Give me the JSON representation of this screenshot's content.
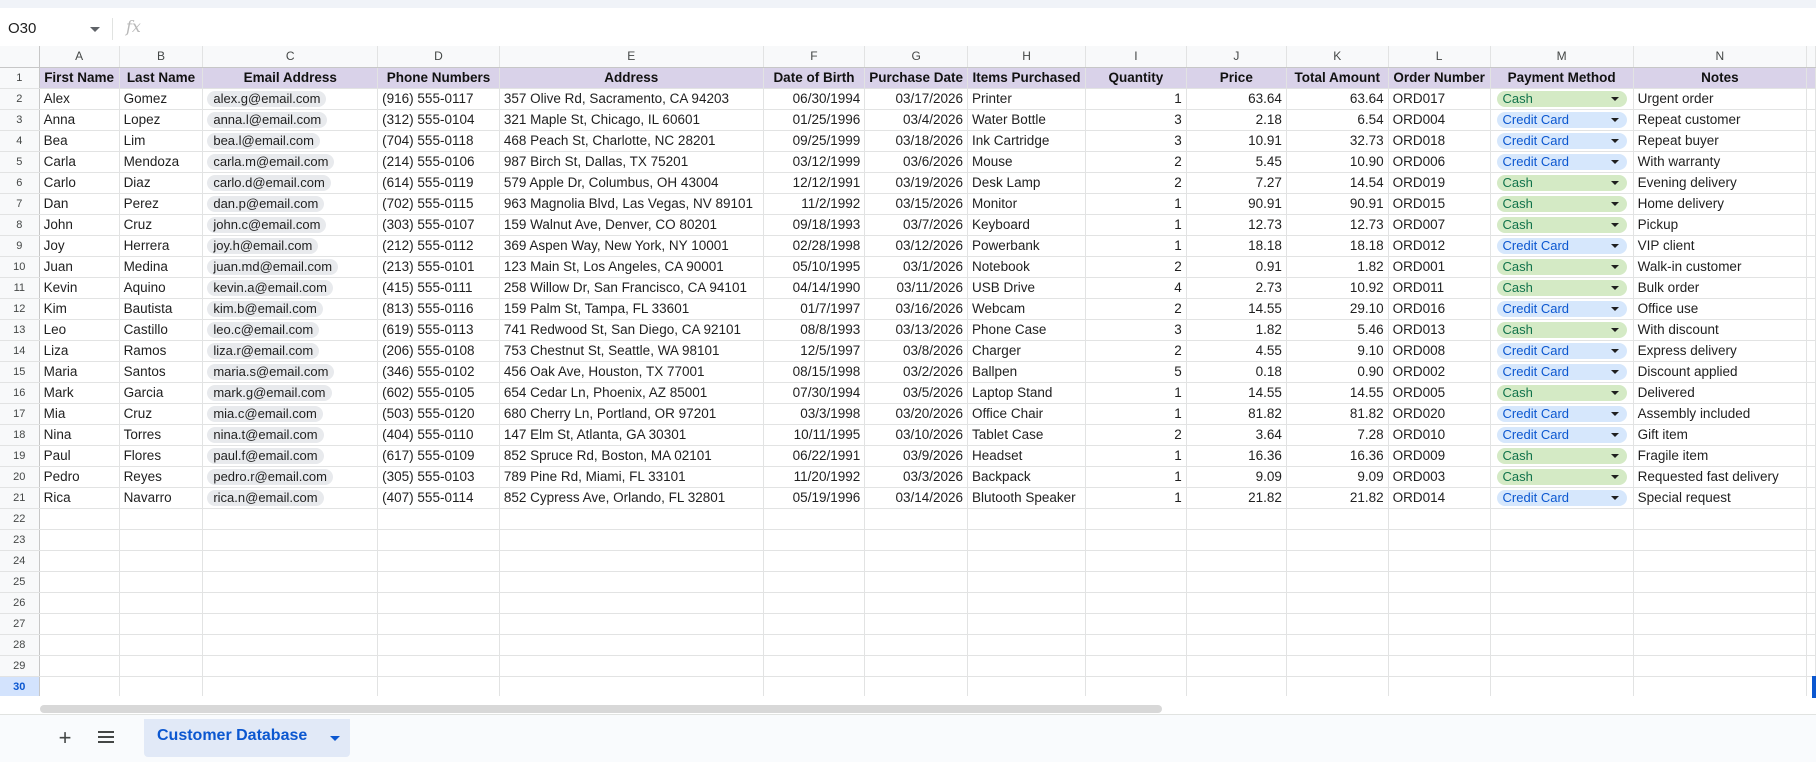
{
  "formula_bar": {
    "cell_ref": "O30",
    "fx_symbol": "fx"
  },
  "columns": [
    "A",
    "B",
    "C",
    "D",
    "E",
    "F",
    "G",
    "H",
    "I",
    "J",
    "K",
    "L",
    "M",
    "N"
  ],
  "headers": [
    "First Name",
    "Last Name",
    "Email Address",
    "Phone Numbers",
    "Address",
    "Date of Birth",
    "Purchase Date",
    "Items Purchased",
    "Quantity",
    "Price",
    "Total Amount",
    "Order Number",
    "Payment Method",
    "Notes"
  ],
  "rows": [
    [
      "Alex",
      "Gomez",
      "alex.g@email.com",
      "(916) 555-0117",
      "357 Olive Rd, Sacramento, CA 94203",
      "06/30/1994",
      "03/17/2026",
      "Printer",
      "1",
      "63.64",
      "63.64",
      "ORD017",
      "Cash",
      "Urgent order"
    ],
    [
      "Anna",
      "Lopez",
      "anna.l@email.com",
      "(312) 555-0104",
      "321 Maple St, Chicago, IL 60601",
      "01/25/1996",
      "03/4/2026",
      "Water Bottle",
      "3",
      "2.18",
      "6.54",
      "ORD004",
      "Credit Card",
      "Repeat customer"
    ],
    [
      "Bea",
      "Lim",
      "bea.l@email.com",
      "(704) 555-0118",
      "468 Peach St, Charlotte, NC 28201",
      "09/25/1999",
      "03/18/2026",
      "Ink Cartridge",
      "3",
      "10.91",
      "32.73",
      "ORD018",
      "Credit Card",
      "Repeat buyer"
    ],
    [
      "Carla",
      "Mendoza",
      "carla.m@email.com",
      "(214) 555-0106",
      "987 Birch St, Dallas, TX 75201",
      "03/12/1999",
      "03/6/2026",
      "Mouse",
      "2",
      "5.45",
      "10.90",
      "ORD006",
      "Credit Card",
      "With warranty"
    ],
    [
      "Carlo",
      "Diaz",
      "carlo.d@email.com",
      "(614) 555-0119",
      "579 Apple Dr, Columbus, OH 43004",
      "12/12/1991",
      "03/19/2026",
      "Desk Lamp",
      "2",
      "7.27",
      "14.54",
      "ORD019",
      "Cash",
      "Evening delivery"
    ],
    [
      "Dan",
      "Perez",
      "dan.p@email.com",
      "(702) 555-0115",
      "963 Magnolia Blvd, Las Vegas, NV 89101",
      "11/2/1992",
      "03/15/2026",
      "Monitor",
      "1",
      "90.91",
      "90.91",
      "ORD015",
      "Cash",
      "Home delivery"
    ],
    [
      "John",
      "Cruz",
      "john.c@email.com",
      "(303) 555-0107",
      "159 Walnut Ave, Denver, CO 80201",
      "09/18/1993",
      "03/7/2026",
      "Keyboard",
      "1",
      "12.73",
      "12.73",
      "ORD007",
      "Cash",
      "Pickup"
    ],
    [
      "Joy",
      "Herrera",
      "joy.h@email.com",
      "(212) 555-0112",
      "369 Aspen Way, New York, NY 10001",
      "02/28/1998",
      "03/12/2026",
      "Powerbank",
      "1",
      "18.18",
      "18.18",
      "ORD012",
      "Credit Card",
      "VIP client"
    ],
    [
      "Juan",
      "Medina",
      "juan.md@email.com",
      "(213) 555-0101",
      "123 Main St, Los Angeles, CA 90001",
      "05/10/1995",
      "03/1/2026",
      "Notebook",
      "2",
      "0.91",
      "1.82",
      "ORD001",
      "Cash",
      "Walk-in customer"
    ],
    [
      "Kevin",
      "Aquino",
      "kevin.a@email.com",
      "(415) 555-0111",
      "258 Willow Dr, San Francisco, CA 94101",
      "04/14/1990",
      "03/11/2026",
      "USB Drive",
      "4",
      "2.73",
      "10.92",
      "ORD011",
      "Cash",
      "Bulk order"
    ],
    [
      "Kim",
      "Bautista",
      "kim.b@email.com",
      "(813) 555-0116",
      "159 Palm St, Tampa, FL 33601",
      "01/7/1997",
      "03/16/2026",
      "Webcam",
      "2",
      "14.55",
      "29.10",
      "ORD016",
      "Credit Card",
      "Office use"
    ],
    [
      "Leo",
      "Castillo",
      "leo.c@email.com",
      "(619) 555-0113",
      "741 Redwood St, San Diego, CA 92101",
      "08/8/1993",
      "03/13/2026",
      "Phone Case",
      "3",
      "1.82",
      "5.46",
      "ORD013",
      "Cash",
      "With discount"
    ],
    [
      "Liza",
      "Ramos",
      "liza.r@email.com",
      "(206) 555-0108",
      "753 Chestnut St, Seattle, WA 98101",
      "12/5/1997",
      "03/8/2026",
      "Charger",
      "2",
      "4.55",
      "9.10",
      "ORD008",
      "Credit Card",
      "Express delivery"
    ],
    [
      "Maria",
      "Santos",
      "maria.s@email.com",
      "(346) 555-0102",
      "456 Oak Ave, Houston, TX 77001",
      "08/15/1998",
      "03/2/2026",
      "Ballpen",
      "5",
      "0.18",
      "0.90",
      "ORD002",
      "Credit Card",
      "Discount applied"
    ],
    [
      "Mark",
      "Garcia",
      "mark.g@email.com",
      "(602) 555-0105",
      "654 Cedar Ln, Phoenix, AZ 85001",
      "07/30/1994",
      "03/5/2026",
      "Laptop Stand",
      "1",
      "14.55",
      "14.55",
      "ORD005",
      "Cash",
      "Delivered"
    ],
    [
      "Mia",
      "Cruz",
      "mia.c@email.com",
      "(503) 555-0120",
      "680 Cherry Ln, Portland, OR 97201",
      "03/3/1998",
      "03/20/2026",
      "Office Chair",
      "1",
      "81.82",
      "81.82",
      "ORD020",
      "Credit Card",
      "Assembly included"
    ],
    [
      "Nina",
      "Torres",
      "nina.t@email.com",
      "(404) 555-0110",
      "147 Elm St, Atlanta, GA 30301",
      "10/11/1995",
      "03/10/2026",
      "Tablet Case",
      "2",
      "3.64",
      "7.28",
      "ORD010",
      "Credit Card",
      "Gift item"
    ],
    [
      "Paul",
      "Flores",
      "paul.f@email.com",
      "(617) 555-0109",
      "852 Spruce Rd, Boston, MA 02101",
      "06/22/1991",
      "03/9/2026",
      "Headset",
      "1",
      "16.36",
      "16.36",
      "ORD009",
      "Cash",
      "Fragile item"
    ],
    [
      "Pedro",
      "Reyes",
      "pedro.r@email.com",
      "(305) 555-0103",
      "789 Pine Rd, Miami, FL 33101",
      "11/20/1992",
      "03/3/2026",
      "Backpack",
      "1",
      "9.09",
      "9.09",
      "ORD003",
      "Cash",
      "Requested fast delivery"
    ],
    [
      "Rica",
      "Navarro",
      "rica.n@email.com",
      "(407) 555-0114",
      "852 Cypress Ave, Orlando, FL 32801",
      "05/19/1996",
      "03/14/2026",
      "Blutooth Speaker",
      "1",
      "21.82",
      "21.82",
      "ORD014",
      "Credit Card",
      "Special request"
    ]
  ],
  "row_numbers": [
    "1",
    "2",
    "3",
    "4",
    "5",
    "6",
    "7",
    "8",
    "9",
    "10",
    "11",
    "12",
    "13",
    "14",
    "15",
    "16",
    "17",
    "18",
    "19",
    "20",
    "21",
    "22",
    "23",
    "24",
    "25",
    "26",
    "27",
    "28",
    "29",
    "30"
  ],
  "active_row": "30",
  "colors": {
    "header_fill": "#d9d2e9",
    "cash_chip": "#d4eac5",
    "credit_card_chip": "#d6e7fc",
    "accent": "#0b57d0"
  },
  "sheet_bar": {
    "add_icon": "plus-icon",
    "list_icon": "menu-icon",
    "active_tab": "Customer Database"
  }
}
